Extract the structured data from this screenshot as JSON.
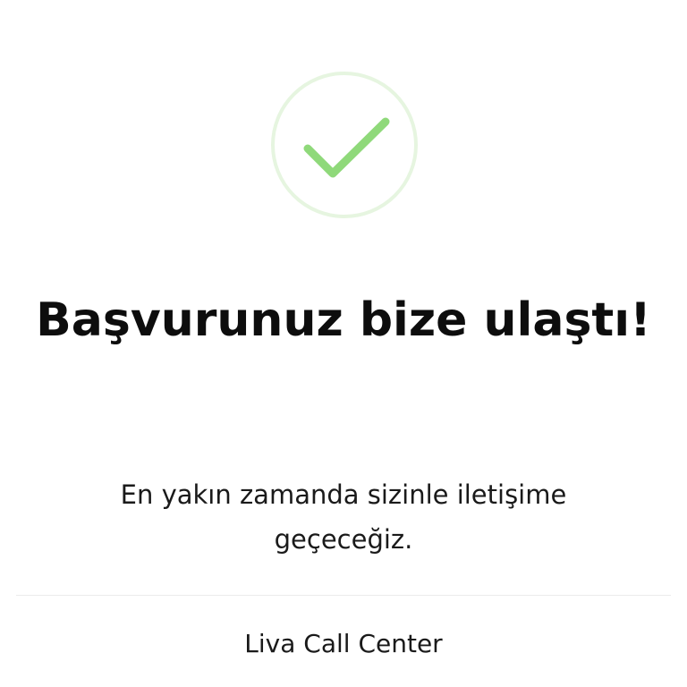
{
  "status": {
    "icon": "check-circle-icon",
    "check_color": "#8fd97a",
    "ring_color": "#e6f5e0"
  },
  "confirmation": {
    "title": "Başvurunuz bize ulaştı!",
    "message": "En yakın zamanda sizinle iletişime geçeceğiz."
  },
  "footer": {
    "link_label": "Liva Call Center"
  }
}
